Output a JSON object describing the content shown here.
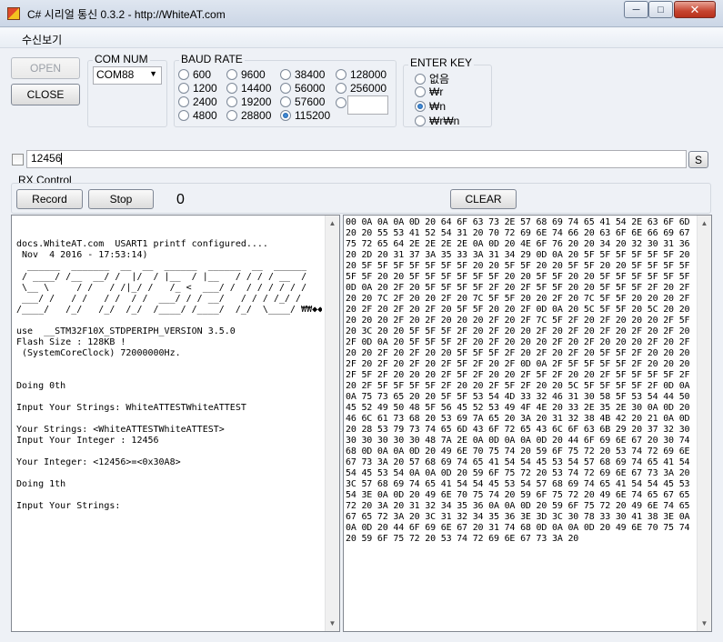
{
  "window": {
    "title": "C# 시리얼 통신 0.3.2 - http://WhiteAT.com",
    "minimize_glyph": "─",
    "maximize_glyph": "□",
    "close_glyph": "✕"
  },
  "menu": {
    "recv_view": "수신보기"
  },
  "connection": {
    "open_label": "OPEN",
    "close_label": "CLOSE"
  },
  "com": {
    "label": "COM NUM",
    "value": "COM88"
  },
  "baud": {
    "label": "BAUD RATE",
    "options": [
      "600",
      "1200",
      "2400",
      "4800",
      "9600",
      "14400",
      "19200",
      "28800",
      "38400",
      "56000",
      "57600",
      "115200",
      "128000",
      "256000"
    ],
    "selected": "115200",
    "custom_value": ""
  },
  "enter_key": {
    "label": "ENTER KEY",
    "options": [
      "없음",
      "₩r",
      "₩n",
      "₩r₩n"
    ],
    "selected": "₩n"
  },
  "send": {
    "input_value": "12456",
    "send_label": "S"
  },
  "rx_control": {
    "label": "RX Control",
    "record_label": "Record",
    "stop_label": "Stop",
    "count": "0",
    "clear_label": "CLEAR"
  },
  "console_lines": [
    "",
    "",
    "docs.WhiteAT.com  USART1 printf configured....",
    " Nov  4 2016 - 17:53:14)",
    "  ______  _______  __  __  ______  ______  __  ______",
    " / ____/ /__  __/ /  |/  / |__  / |__   / / / / __  /",
    " \\__ \\     / /   / /|_/ /   /_ <  ___/ /  / / / / / /",
    " ___/ /   / /   / /  / /  ___/ / / __/   / / / /_/ /",
    "/____/   /_/   /_/  /_/  /____/ /____/  /_/  \\____/ ₩₩◆◆",
    "",
    "use  __STM32F10X_STDPERIPH_VERSION 3.5.0",
    "Flash Size : 128KB !",
    " (SystemCoreClock) 72000000Hz.",
    "",
    "",
    "Doing 0th",
    "",
    "Input Your Strings: WhiteATTESTWhiteATTEST",
    "",
    "Your Strings: <WhiteATTESTWhiteATTEST>",
    "Input Your Integer : 12456",
    "",
    "Your Integer: <12456>=<0x30A8>",
    "",
    "Doing 1th",
    "",
    "Input Your Strings:"
  ],
  "hex_dump": "00 0A 0A 0A 0D 20 64 6F 63 73 2E 57 68 69 74 65 41 54 2E 63 6F 6D 20 20 55 53 41 52 54 31 20 70 72 69 6E 74 66 20 63 6F 6E 66 69 67 75 72 65 64 2E 2E 2E 2E 0A 0D 20 4E 6F 76 20 20 34 20 32 30 31 36 20 2D 20 31 37 3A 35 33 3A 31 34 29 0D 0A 20 5F 5F 5F 5F 5F 5F 20 20 5F 5F 5F 5F 5F 5F 5F 20 20 5F 5F 20 20 5F 5F 20 20 5F 5F 5F 5F 5F 5F 20 20 5F 5F 5F 5F 5F 5F 20 20 5F 5F 20 20 5F 5F 5F 5F 5F 5F 0D 0A 20 2F 20 5F 5F 5F 5F 2F 20 2F 5F 5F 20 20 5F 5F 5F 2F 20 2F 20 20 7C 2F 20 20 2F 20 7C 5F 5F 20 20 2F 20 7C 5F 5F 20 20 20 2F 20 2F 20 2F 20 2F 20 5F 5F 20 20 2F 0D 0A 20 5C 5F 5F 20 5C 20 20 20 20 20 2F 20 2F 20 20 20 2F 20 2F 7C 5F 2F 20 2F 20 20 20 2F 5F 20 3C 20 20 5F 5F 5F 2F 20 2F 20 20 2F 20 2F 20 2F 20 2F 20 2F 20 2F 0D 0A 20 5F 5F 5F 2F 20 2F 20 20 20 2F 20 2F 20 20 20 2F 20 2F 20 20 2F 20 2F 20 20 5F 5F 5F 2F 20 2F 20 2F 20 5F 5F 2F 20 20 20 2F 20 2F 20 2F 20 2F 5F 2F 20 2F 0D 0A 2F 5F 5F 5F 5F 2F 20 20 20 2F 5F 2F 20 20 20 2F 5F 2F 20 20 2F 5F 2F 20 20 2F 5F 5F 5F 5F 2F 20 2F 5F 5F 5F 5F 2F 20 20 2F 5F 2F 20 20 5C 5F 5F 5F 5F 2F 0D 0A 0A 75 73 65 20 20 5F 5F 53 54 4D 33 32 46 31 30 58 5F 53 54 44 50 45 52 49 50 48 5F 56 45 52 53 49 4F 4E 20 33 2E 35 2E 30 0A 0D 20 46 6C 61 73 68 20 53 69 7A 65 20 3A 20 31 32 38 4B 42 20 21 0A 0D 20 28 53 79 73 74 65 6D 43 6F 72 65 43 6C 6F 63 6B 29 20 37 32 30 30 30 30 30 30 48 7A 2E 0A 0D 0A 0A 0D 20 44 6F 69 6E 67 20 30 74 68 0D 0A 0A 0D 20 49 6E 70 75 74 20 59 6F 75 72 20 53 74 72 69 6E 67 73 3A 20 57 68 69 74 65 41 54 54 45 53 54 57 68 69 74 65 41 54 54 45 53 54 0A 0A 0D 20 59 6F 75 72 20 53 74 72 69 6E 67 73 3A 20 3C 57 68 69 74 65 41 54 54 45 53 54 57 68 69 74 65 41 54 54 45 53 54 3E 0A 0D 20 49 6E 70 75 74 20 59 6F 75 72 20 49 6E 74 65 67 65 72 20 3A 20 31 32 34 35 36 0A 0A 0D 20 59 6F 75 72 20 49 6E 74 65 67 65 72 3A 20 3C 31 32 34 35 36 3E 3D 3C 30 78 33 30 41 38 3E 0A 0A 0D 20 44 6F 69 6E 67 20 31 74 68 0D 0A 0A 0D 20 49 6E 70 75 74 20 59 6F 75 72 20 53 74 72 69 6E 67 73 3A 20"
}
